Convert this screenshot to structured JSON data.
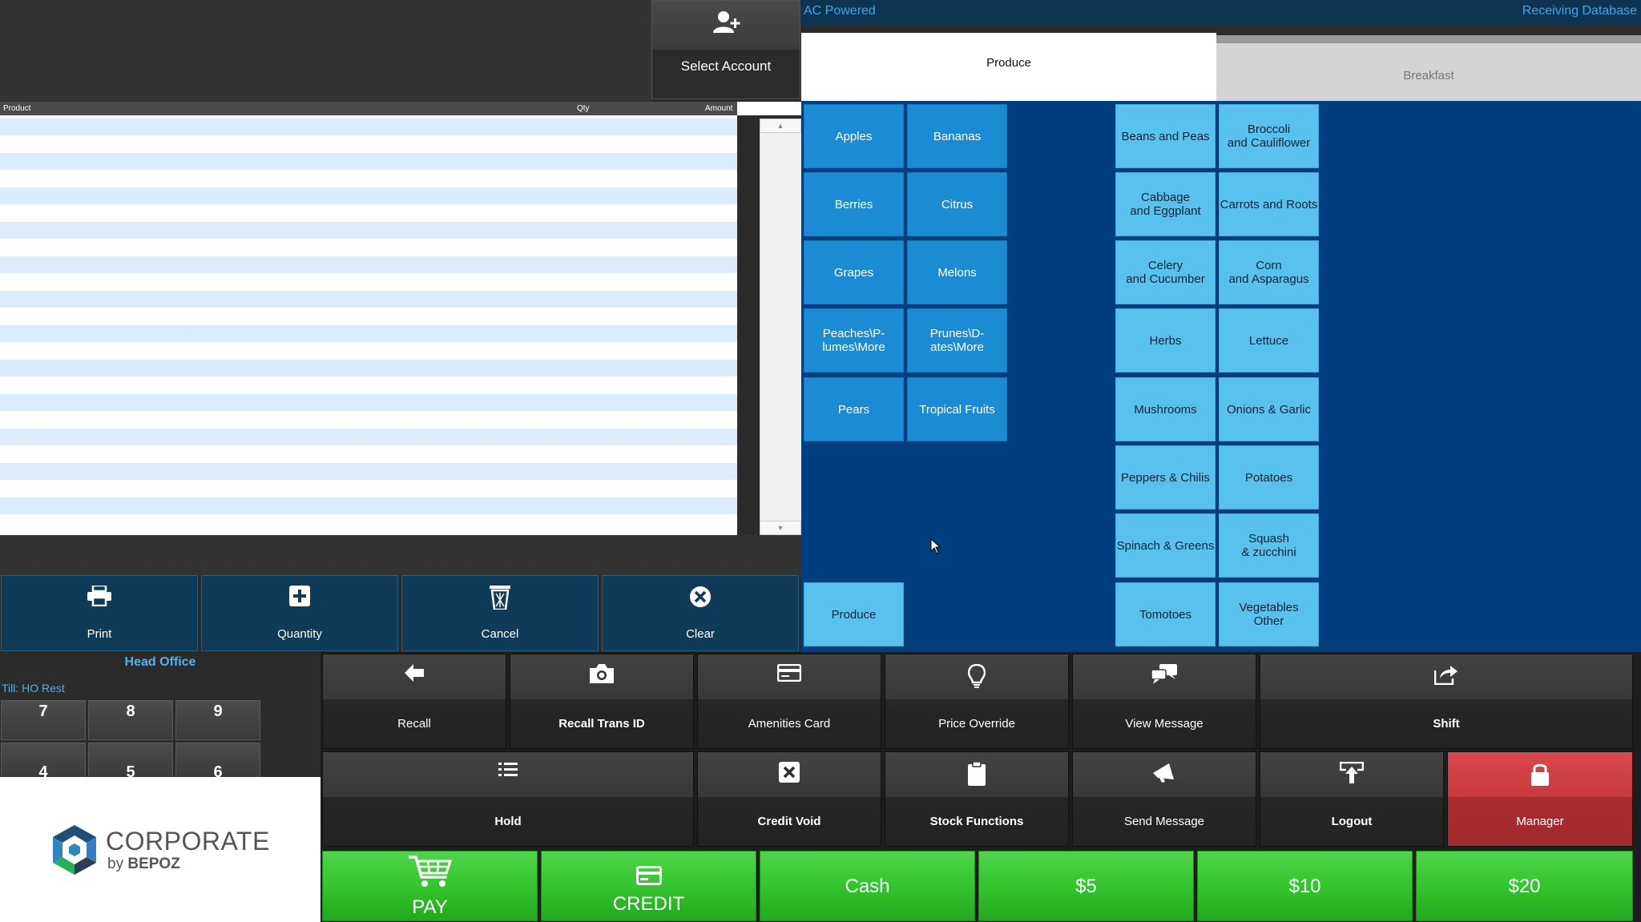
{
  "header": {
    "select_account": "Select Account",
    "status": "AC Powered",
    "database": "Receiving Database"
  },
  "receipt": {
    "col_product": "Product",
    "col_qty": "Qty",
    "col_amount": "Amount",
    "scroll_up": "▲",
    "scroll_down": "▼"
  },
  "actions": {
    "print": "Print",
    "quantity": "Quantity",
    "cancel": "Cancel",
    "clear": "Clear"
  },
  "till": {
    "location": "Head Office",
    "till_label": "Till: HO Rest",
    "keys": [
      "7",
      "8",
      "9",
      "4",
      "5",
      "6"
    ]
  },
  "logo": {
    "name": "CORPORATE",
    "by": "by",
    "brand": "BEPOZ"
  },
  "tabs": {
    "produce": "Produce",
    "breakfast": "Breakfast"
  },
  "fruits": [
    "Apples",
    "Bananas",
    "Berries",
    "Citrus",
    "Grapes",
    "Melons",
    "Peaches\\P-\nlumes\\More",
    "Prunes\\D-\nates\\More",
    "Pears",
    "Tropical Fruits"
  ],
  "produce_group": "Produce",
  "vegetables": [
    "Beans and Peas",
    "Broccoli\nand Cauliflower",
    "Cabbage\nand Eggplant",
    "Carrots and Roots",
    "Celery\nand Cucumber",
    "Corn\nand Asparagus",
    "Herbs",
    "Lettuce",
    "Mushrooms",
    "Onions & Garlic",
    "Peppers & Chilis",
    "Potatoes",
    "Spinach & Greens",
    "Squash\n& zucchini",
    "Tomotoes",
    "Vegetables\nOther"
  ],
  "functions": {
    "recall": "Recall",
    "recall_trans_id": "Recall Trans ID",
    "amenities_card": "Amenities Card",
    "price_override": "Price Override",
    "view_message": "View Message",
    "shift": "Shift",
    "hold": "Hold",
    "credit_void": "Credit Void",
    "stock_functions": "Stock Functions",
    "send_message": "Send Message",
    "logout": "Logout",
    "manager": "Manager"
  },
  "tender": {
    "pay": "PAY",
    "credit": "CREDIT",
    "cash": "Cash",
    "five": "$5",
    "ten": "$10",
    "twenty": "$20"
  },
  "colors": {
    "grid_bg": "#003f7f",
    "fruit_btn": "#1b8bd3",
    "veg_btn": "#58c1ee",
    "tender_green": "#34c52f",
    "manager_red": "#c63a3e",
    "status_text": "#39a9ea"
  }
}
